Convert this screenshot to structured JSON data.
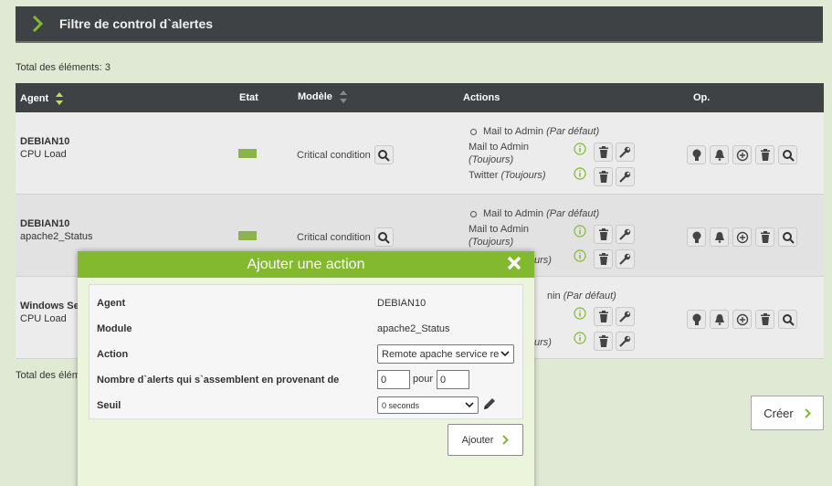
{
  "filter_bar": {
    "title": "Filtre de control d`alertes"
  },
  "total_top": "Total des éléments: 3",
  "total_bottom": "Total des élém",
  "columns": {
    "agent": "Agent",
    "state": "Etat",
    "model": "Modèle",
    "actions": "Actions",
    "ops": "Op."
  },
  "rows": [
    {
      "agent": "DEBIAN10",
      "module": "CPU Load",
      "model": "Critical condition",
      "default_action": {
        "name": "Mail to Admin",
        "note": "(Par défaut)"
      },
      "actions": [
        {
          "name": "Mail to Admin",
          "note": "(Toujours)"
        },
        {
          "name": "Twitter",
          "note": "(Toujours)"
        }
      ]
    },
    {
      "agent": "DEBIAN10",
      "module": "apache2_Status",
      "model": "Critical condition",
      "default_action": {
        "name": "Mail to Admin",
        "note": "(Par défaut)"
      },
      "actions": [
        {
          "name": "Mail to Admin",
          "note": "(Toujours)"
        },
        {
          "name": "",
          "note": "urs)"
        }
      ]
    },
    {
      "agent": "Windows Se",
      "module": "CPU Load",
      "model": "",
      "default_action": {
        "name": "nin",
        "note": "(Par défaut)"
      },
      "actions": [
        {
          "name": "",
          "note": ""
        },
        {
          "name": "",
          "note": "urs)"
        }
      ]
    }
  ],
  "create_button": "Créer",
  "modal": {
    "title": "Ajouter une action",
    "agent_label": "Agent",
    "agent_value": "DEBIAN10",
    "module_label": "Module",
    "module_value": "apache2_Status",
    "action_label": "Action",
    "action_value": "Remote apache service re",
    "alerts_label": "Nombre d`alerts qui s`assemblent en provenant de",
    "from_value": "0",
    "pour_label": "pour",
    "to_value": "0",
    "threshold_label": "Seuil",
    "threshold_value": "0 seconds",
    "add_button": "Ajouter"
  },
  "colors": {
    "accent": "#82b92e",
    "header": "#3f4245",
    "state_ok": "#8db44a",
    "background": "#dfe9d3"
  }
}
